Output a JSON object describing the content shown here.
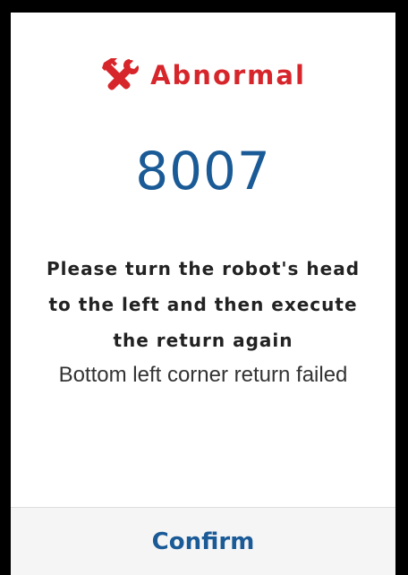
{
  "dialog": {
    "status_label": "Abnormal",
    "status_icon": "tools-icon",
    "error_code": "8007",
    "message": "Please turn the robot's head to the left and then execute the return again",
    "detail": "Bottom left corner return failed",
    "confirm_label": "Confirm"
  },
  "colors": {
    "status": "#d7262b",
    "accent": "#1a5a96",
    "footer_bg": "#f5f5f5"
  }
}
